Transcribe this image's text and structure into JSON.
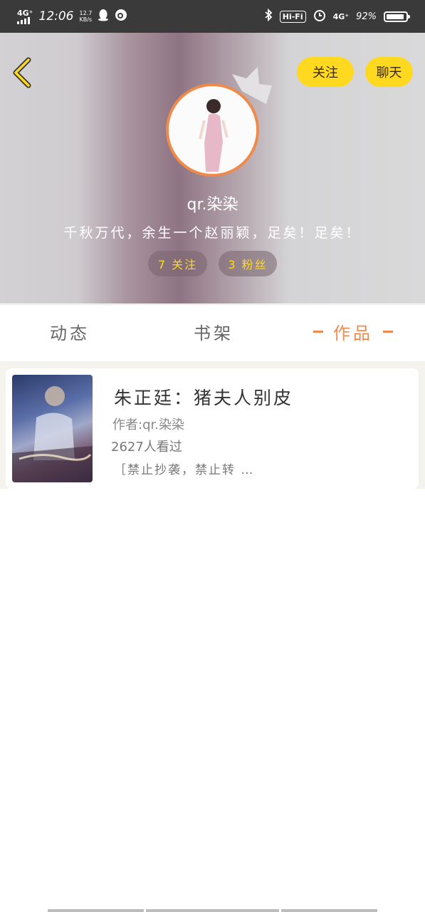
{
  "status_bar": {
    "network": "4G⁺",
    "time": "12:06",
    "speed_value": "12.7",
    "speed_unit": "KB/s",
    "network_right": "4G⁺",
    "hifi": "Hi-Fi",
    "battery_percent": "92%",
    "battery_level": 0.92
  },
  "header": {
    "follow_button": "关注",
    "chat_button": "聊天",
    "username": "qr.染染",
    "signature": "千秋万代，余生一个赵丽颖，足矣！足矣！",
    "following_pill": "7 关注",
    "fans_pill": "3 粉丝"
  },
  "tabs": {
    "dongtai": "动态",
    "shujia": "书架",
    "zuopin": "作品"
  },
  "works": [
    {
      "title": "朱正廷：猪夫人别皮",
      "author": "作者:qr.染染",
      "views": "2627人看过",
      "intro": "［禁止抄袭，禁止转 …"
    }
  ],
  "colors": {
    "accent_yellow": "#ffd91f",
    "accent_orange": "#ee8a4c"
  }
}
